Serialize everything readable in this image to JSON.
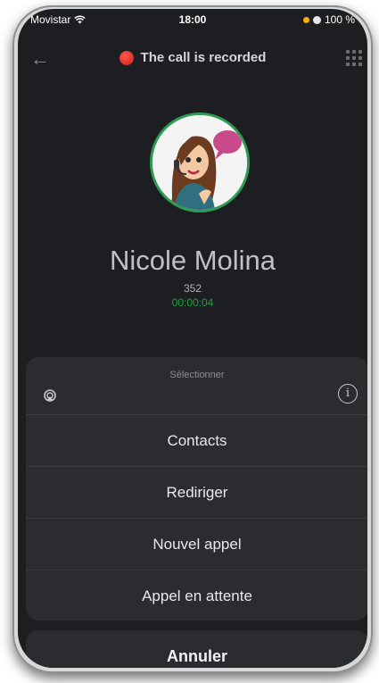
{
  "status_bar": {
    "carrier": "Movistar",
    "time": "18:00",
    "battery": "100 %"
  },
  "call": {
    "recording_text": "The call is recorded",
    "contact_name": "Nicole Molina",
    "extension": "352",
    "duration": "00:00:04"
  },
  "action_sheet": {
    "title": "Sélectionner",
    "options": [
      {
        "label": "Contacts"
      },
      {
        "label": "Rediriger"
      },
      {
        "label": "Nouvel appel"
      },
      {
        "label": "Appel en attente"
      }
    ],
    "cancel_label": "Annuler"
  },
  "icons": {
    "back": "back-arrow-icon",
    "keypad": "keypad-icon",
    "info": "info-icon",
    "airplay": "airplay-icon"
  },
  "colors": {
    "recording": "#e0271f",
    "timer": "#19a33d",
    "avatar_ring": "#2f9a54",
    "background": "#1d1e21",
    "sheet": "#2b2c2f"
  }
}
